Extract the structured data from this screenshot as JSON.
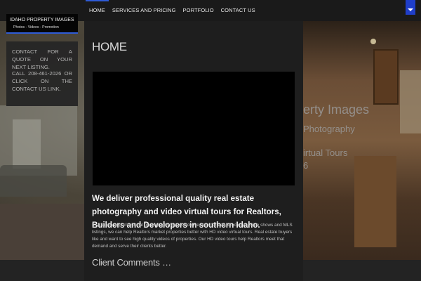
{
  "nav": {
    "items": [
      {
        "label": "HOME"
      },
      {
        "label": "SERVICES AND PRICING"
      },
      {
        "label": "PORTFOLIO"
      },
      {
        "label": "CONTACT US"
      }
    ]
  },
  "logo": {
    "title": "IDAHO PROPERTY IMAGES",
    "subtitle": "Photos - Videos - Promotion"
  },
  "sidebar": {
    "line1": "CONTACT FOR A QUOTE ON YOUR NEXT LISTING.",
    "line2": "CALL 208-461-2026 OR CLICK ON THE CONTACT US LINK."
  },
  "background_text": {
    "line1": "erty Images",
    "line2": "Photography",
    "line3": "irtual Tours",
    "line4": "6"
  },
  "main": {
    "title": "HOME",
    "headline": "We deliver professional quality real estate photography and video virtual tours for Realtors,  Builders and Developers in southern Idaho.",
    "body": "In addition to professional photography we provide Realtors for ads, brochures, slide shows and MLS listings, we can help Realtors market properties better with HD video virtual tours. Real estate buyers like and want to see high quality videos of properties. Our HD video tours help Realtors meet that demand and serve their clients better.",
    "subheading": "Client Comments …"
  },
  "colors": {
    "accent": "#2f5bd6",
    "menu_toggle": "#1f3ec9"
  }
}
